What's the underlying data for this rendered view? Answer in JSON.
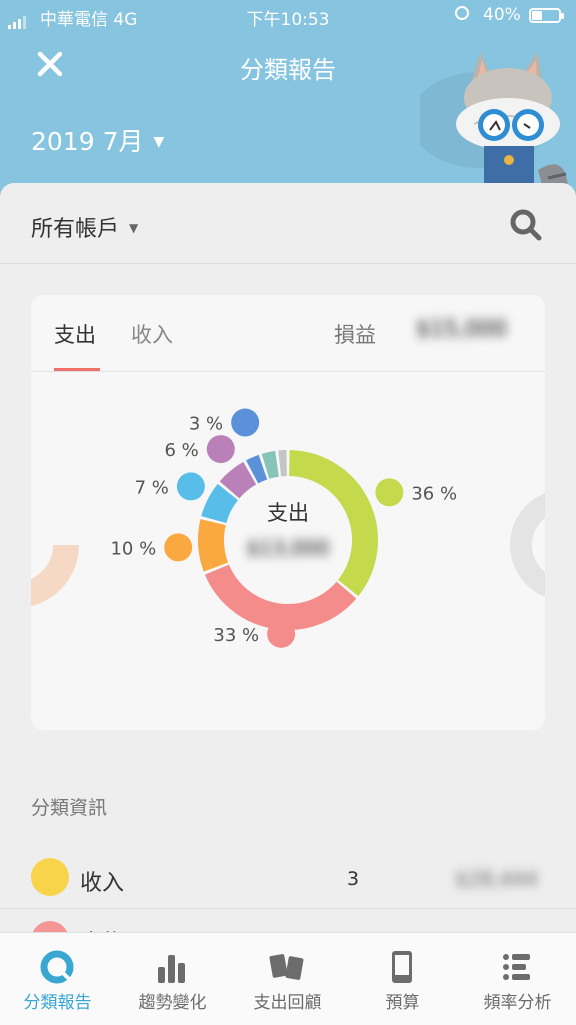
{
  "status": {
    "carrier": "中華電信  4G",
    "time": "下午10:53",
    "battery": "40%"
  },
  "header": {
    "title": "分類報告",
    "month": "2019 7月"
  },
  "account": {
    "label": "所有帳戶"
  },
  "card": {
    "tabs": [
      "支出",
      "收入"
    ],
    "pl_label": "損益",
    "pl_value": "$15,000",
    "center_label": "支出",
    "center_value": "$13,000"
  },
  "chart_data": {
    "type": "pie",
    "categories": [
      "home",
      "food",
      "games",
      "transport",
      "shopping",
      "mobile",
      "other1",
      "other2"
    ],
    "values": [
      36,
      33,
      10,
      7,
      6,
      3,
      3,
      2
    ],
    "labels": [
      "36 %",
      "33 %",
      "10 %",
      "7 %",
      "6 %",
      "3 %"
    ],
    "colors": [
      "#c5d94c",
      "#f58c8c",
      "#f9a940",
      "#59bde9",
      "#ba80b8",
      "#5b91d8",
      "#86c3b9",
      "#c5c5c5"
    ]
  },
  "category_info": {
    "title": "分類資訊",
    "rows": [
      {
        "label": "收入",
        "count": "3",
        "amount": "$28,444"
      },
      {
        "label": "食物"
      }
    ]
  },
  "tabbar": {
    "items": [
      {
        "label": "分類報告"
      },
      {
        "label": "趨勢變化"
      },
      {
        "label": "支出回顧"
      },
      {
        "label": "預算"
      },
      {
        "label": "頻率分析"
      }
    ]
  },
  "colors": {
    "header": "#86c4e0",
    "accent": "#f0706c",
    "active_tab": "#3aa6d2"
  }
}
